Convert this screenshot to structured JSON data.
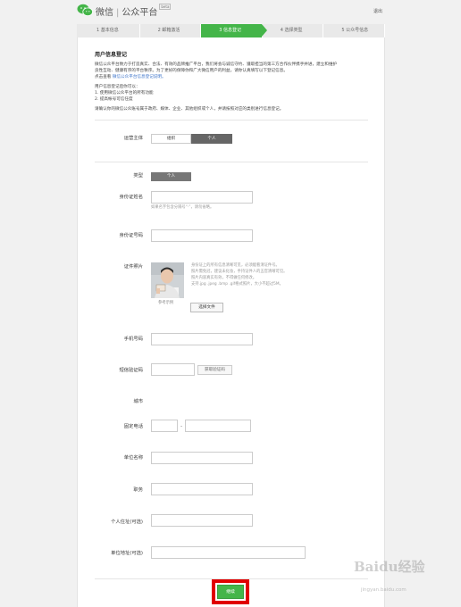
{
  "header": {
    "app_name": "微信",
    "platform_name": "公众平台",
    "badge": "beta",
    "logout": "退出"
  },
  "steps": [
    {
      "label": "1 基本信息",
      "active": false
    },
    {
      "label": "2 邮箱激活",
      "active": false
    },
    {
      "label": "3 信息登记",
      "active": true
    },
    {
      "label": "4 选择类型",
      "active": false
    },
    {
      "label": "5 公众号信息",
      "active": false
    }
  ],
  "intro": {
    "title": "用户信息登记",
    "lines": [
      "微信公众平台致力于打造真实、合法、有效的品牌推广平台，我们将会与诚信守约、遵取担当的第三方合作伙伴携手并进，建立和维护",
      "良性互动、健康有序的平台秩序。为了更好的保障你和广大微信用户的利益，请你认真填写以下登记信息。"
    ],
    "view_prefix": "点击查看",
    "link_text": "微信公众平台信息登记说明。",
    "after_title": "用户信息登记后你可以：",
    "benefits": [
      "1. 使用微信公众平台的所有功能",
      "2. 提高帐号可信任度"
    ],
    "note": "请确认你的微信公众账号属于政府、媒体、企业、其他组织或个人，并请按照对应的类别进行信息登记。"
  },
  "form": {
    "entity_label": "运营主体",
    "entity_options": [
      {
        "label": "组织",
        "selected": false
      },
      {
        "label": "个人",
        "selected": true
      }
    ],
    "type_label": "类型",
    "type_value": "个人",
    "id_name_label": "身份证姓名",
    "id_name_value": "",
    "id_name_hint": "如果名字包含分隔号“·”，请勿省略。",
    "id_number_label": "身份证号码",
    "id_number_value": "",
    "photo_label": "证件照片",
    "photo_hints": [
      "身份证上的所有信息清晰可见，必须能看清证件号。",
      "照片需免冠，建议未化妆，手持证件人的五官清晰可见。",
      "照片内容真实有效，不得做任何修改。",
      "支持.jpg .jpeg .bmp .gif格式照片，大小不超过5M。"
    ],
    "photo_caption": "参考示例",
    "file_button": "选择文件",
    "phone_label": "手机号码",
    "phone_value": "",
    "sms_label": "短信验证码",
    "sms_value": "",
    "sms_button": "获取验证码",
    "city_label": "城市",
    "landline_label": "固定电话",
    "landline_sep": "-",
    "area_code_value": "",
    "landline_value": "",
    "company_label": "单位名称",
    "company_value": "",
    "position_label": "职务",
    "position_value": "",
    "home_address_label": "个人住址(可选)",
    "home_address_value": "",
    "work_address_label": "单位地址(可选)",
    "work_address_value": "",
    "submit": "继续"
  },
  "watermark": {
    "brand": "Baidu经验",
    "url": "jingyan.baidu.com"
  },
  "colors": {
    "accent": "#44b549",
    "highlight": "#e00000",
    "link": "#3b73c9"
  }
}
